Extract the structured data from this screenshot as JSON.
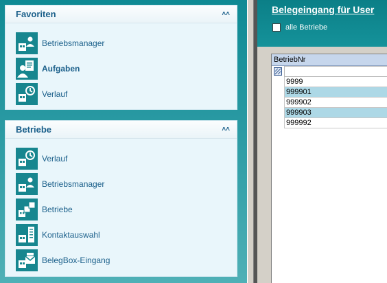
{
  "favorites": {
    "title": "Favoriten",
    "items": [
      {
        "label": "Betriebsmanager",
        "icon": "betriebsmanager-icon",
        "bold": false
      },
      {
        "label": "Aufgaben",
        "icon": "aufgaben-icon",
        "bold": true
      },
      {
        "label": "Verlauf",
        "icon": "verlauf-icon",
        "bold": false
      }
    ]
  },
  "betriebe": {
    "title": "Betriebe",
    "items": [
      {
        "label": "Verlauf",
        "icon": "verlauf-icon"
      },
      {
        "label": "Betriebsmanager",
        "icon": "betriebsmanager-icon"
      },
      {
        "label": "Betriebe",
        "icon": "betriebe-icon"
      },
      {
        "label": "Kontaktauswahl",
        "icon": "kontaktauswahl-icon"
      },
      {
        "label": "BelegBox-Eingang",
        "icon": "belegbox-icon"
      }
    ]
  },
  "right": {
    "title": "Belegeingang für User",
    "all_label": "alle Betriebe",
    "column_header": "BetriebNr",
    "rows": [
      "9999",
      "999901",
      "999902",
      "999903",
      "999992"
    ]
  },
  "colors": {
    "teal": "#0f8a94",
    "panel_bg": "#e9f6fb",
    "label_blue": "#1a5f8a",
    "row_highlight": "#add8e6"
  }
}
